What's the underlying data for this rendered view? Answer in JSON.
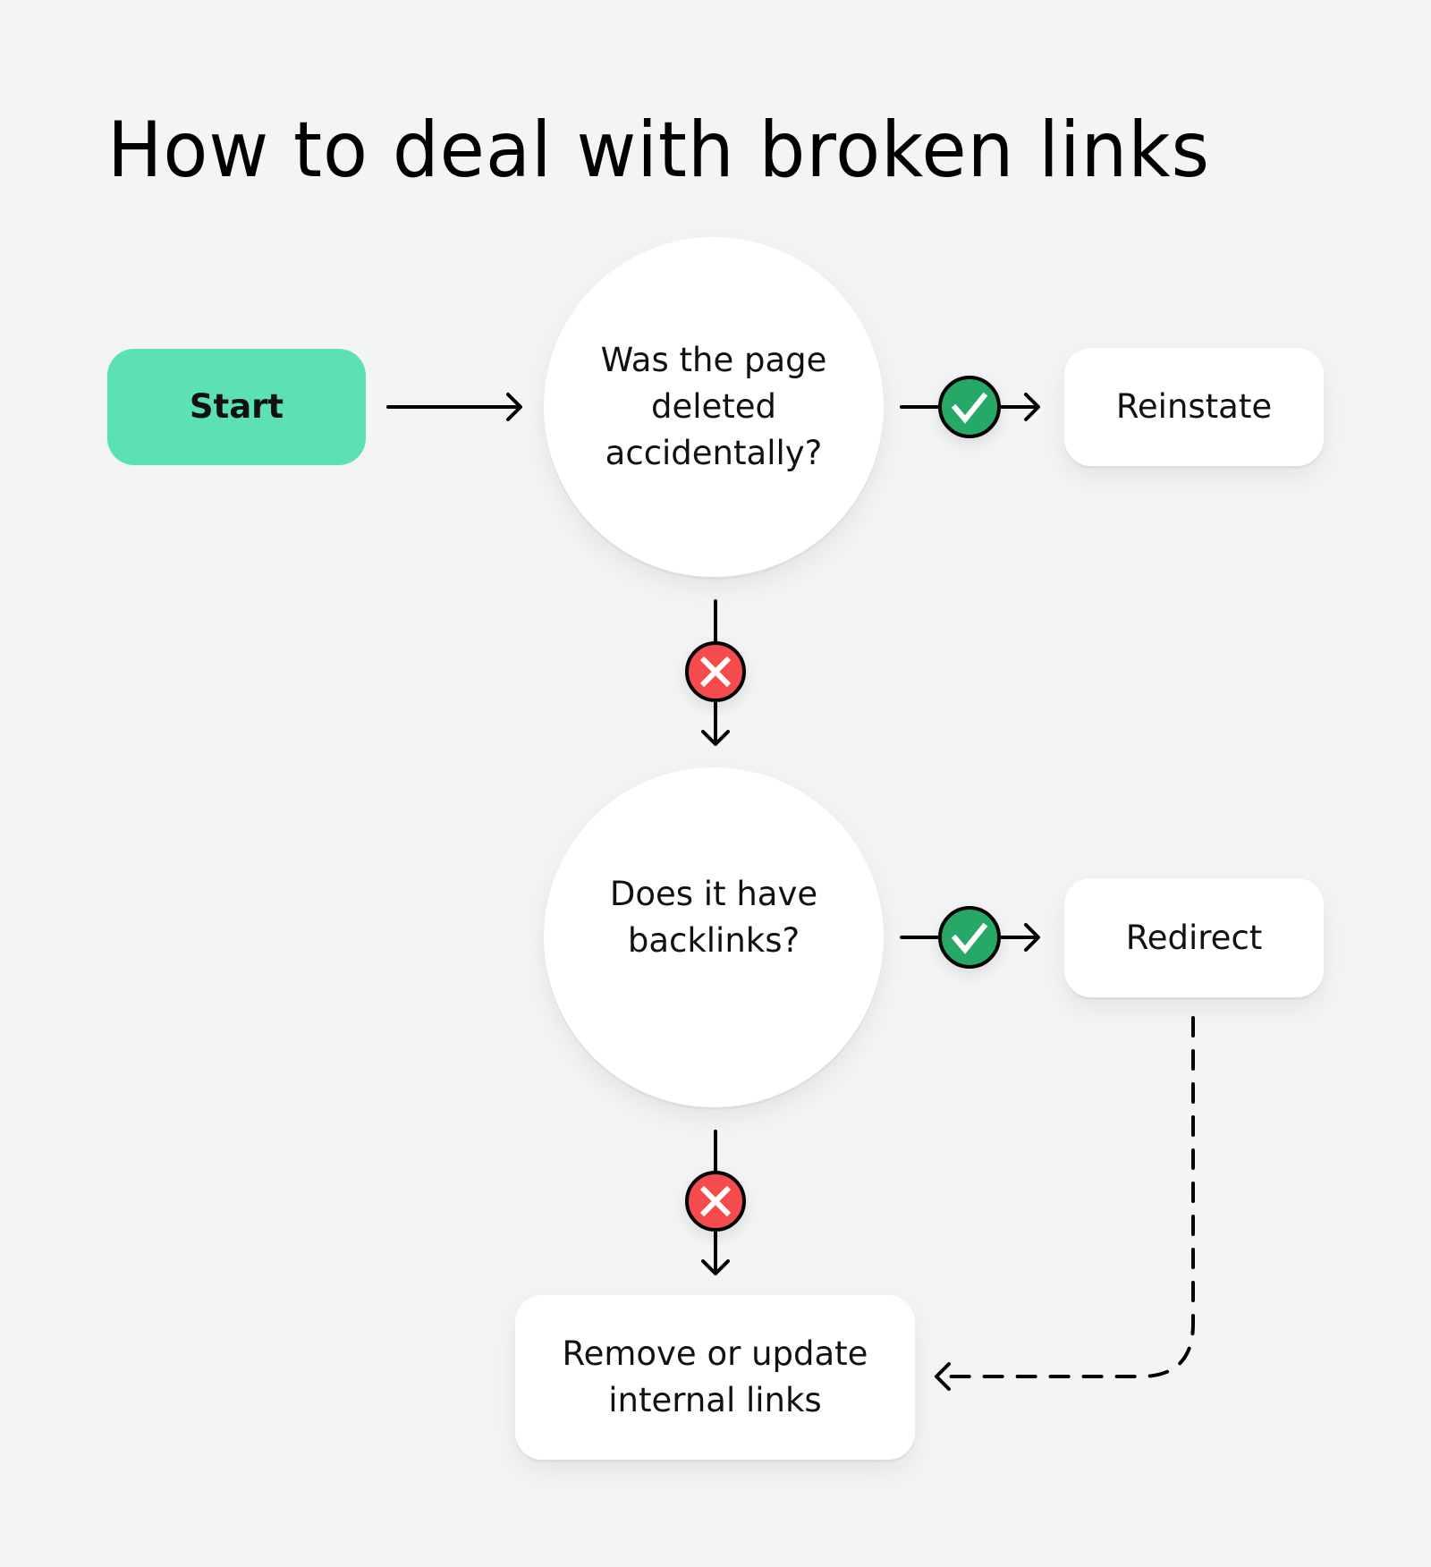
{
  "title": "How to deal with broken links",
  "nodes": {
    "start": "Start",
    "question_1": "Was the page\ndeleted\naccidentally?",
    "question_2": "Does it have\nbacklinks?",
    "reinstate": "Reinstate",
    "redirect": "Redirect",
    "remove": "Remove or update\ninternal links"
  },
  "edges": [
    {
      "from": "start",
      "to": "question_1",
      "label": ""
    },
    {
      "from": "question_1",
      "to": "reinstate",
      "label": "yes",
      "icon": "check-icon"
    },
    {
      "from": "question_1",
      "to": "question_2",
      "label": "no",
      "icon": "cross-icon"
    },
    {
      "from": "question_2",
      "to": "redirect",
      "label": "yes",
      "icon": "check-icon"
    },
    {
      "from": "question_2",
      "to": "remove",
      "label": "no",
      "icon": "cross-icon"
    },
    {
      "from": "redirect",
      "to": "remove",
      "label": "",
      "style": "dashed"
    }
  ],
  "colors": {
    "background": "#f3f4f6",
    "start_fill": "#5ce1b7",
    "yes_fill": "#27a866",
    "no_fill": "#f44b4f",
    "node_fill": "#ffffff"
  }
}
